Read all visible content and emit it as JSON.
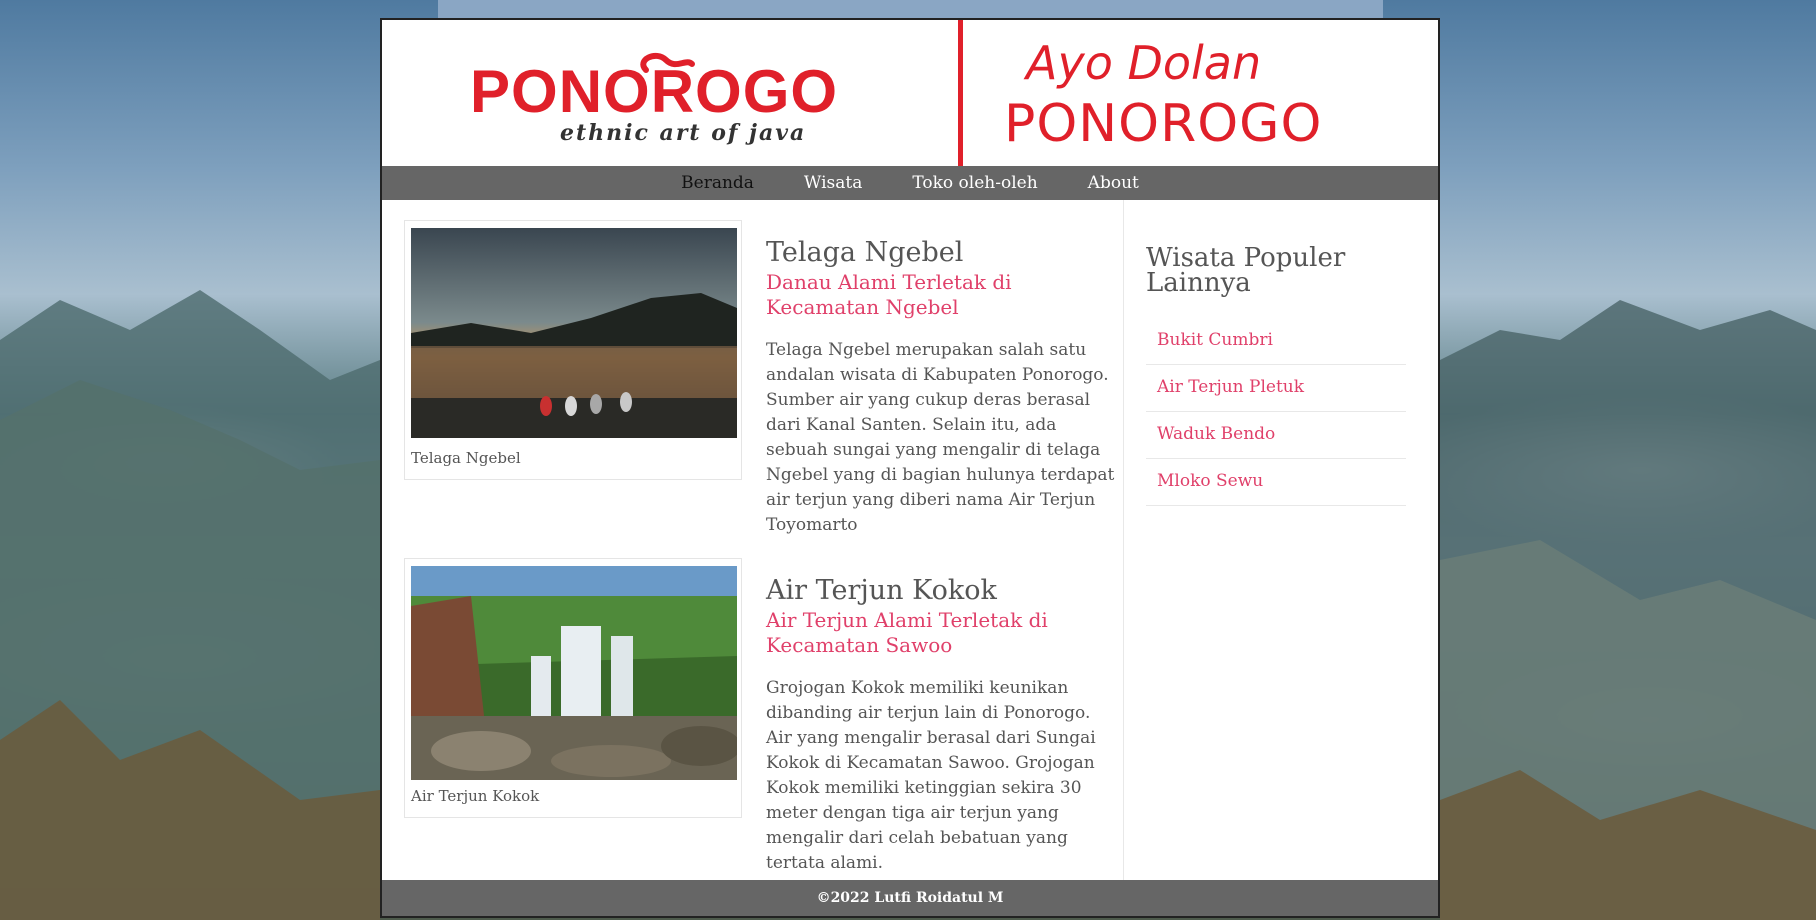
{
  "header": {
    "logo_text": "PONOROGO",
    "logo_subtitle": "ethnic art of java",
    "tagline_line1": "Ayo Dolan",
    "tagline_line2": "PONOROGO"
  },
  "nav": {
    "items": [
      {
        "label": "Beranda",
        "active": true
      },
      {
        "label": "Wisata",
        "active": false
      },
      {
        "label": "Toko oleh-oleh",
        "active": false
      },
      {
        "label": "About",
        "active": false
      }
    ]
  },
  "articles": [
    {
      "image_caption": "Telaga Ngebel",
      "title": "Telaga Ngebel",
      "subtitle": "Danau Alami Terletak di Kecamatan Ngebel",
      "body": "Telaga Ngebel merupakan salah satu andalan wisata di Kabupaten Ponorogo. Sumber air yang cukup deras berasal dari Kanal Santen. Selain itu, ada sebuah sungai yang mengalir di telaga Ngebel yang di bagian hulunya terdapat air terjun yang diberi nama Air Terjun Toyomarto"
    },
    {
      "image_caption": "Air Terjun Kokok",
      "title": "Air Terjun Kokok",
      "subtitle": "Air Terjun Alami Terletak di Kecamatan Sawoo",
      "body": "Grojogan Kokok memiliki keunikan dibanding air terjun lain di Ponorogo. Air yang mengalir berasal dari Sungai Kokok di Kecamatan Sawoo. Grojogan Kokok memiliki ketinggian sekira 30 meter dengan tiga air terjun yang mengalir dari celah bebatuan yang tertata alami."
    }
  ],
  "sidebar": {
    "title": "Wisata Populer Lainnya",
    "items": [
      "Bukit Cumbri",
      "Air Terjun Pletuk",
      "Waduk Bendo",
      "Mloko Sewu"
    ]
  },
  "footer": {
    "text": "©2022 Lutfi Roidatul M"
  },
  "colors": {
    "brand_red": "#e0202a",
    "link_pink": "#e0406a",
    "nav_bg": "#666666"
  }
}
